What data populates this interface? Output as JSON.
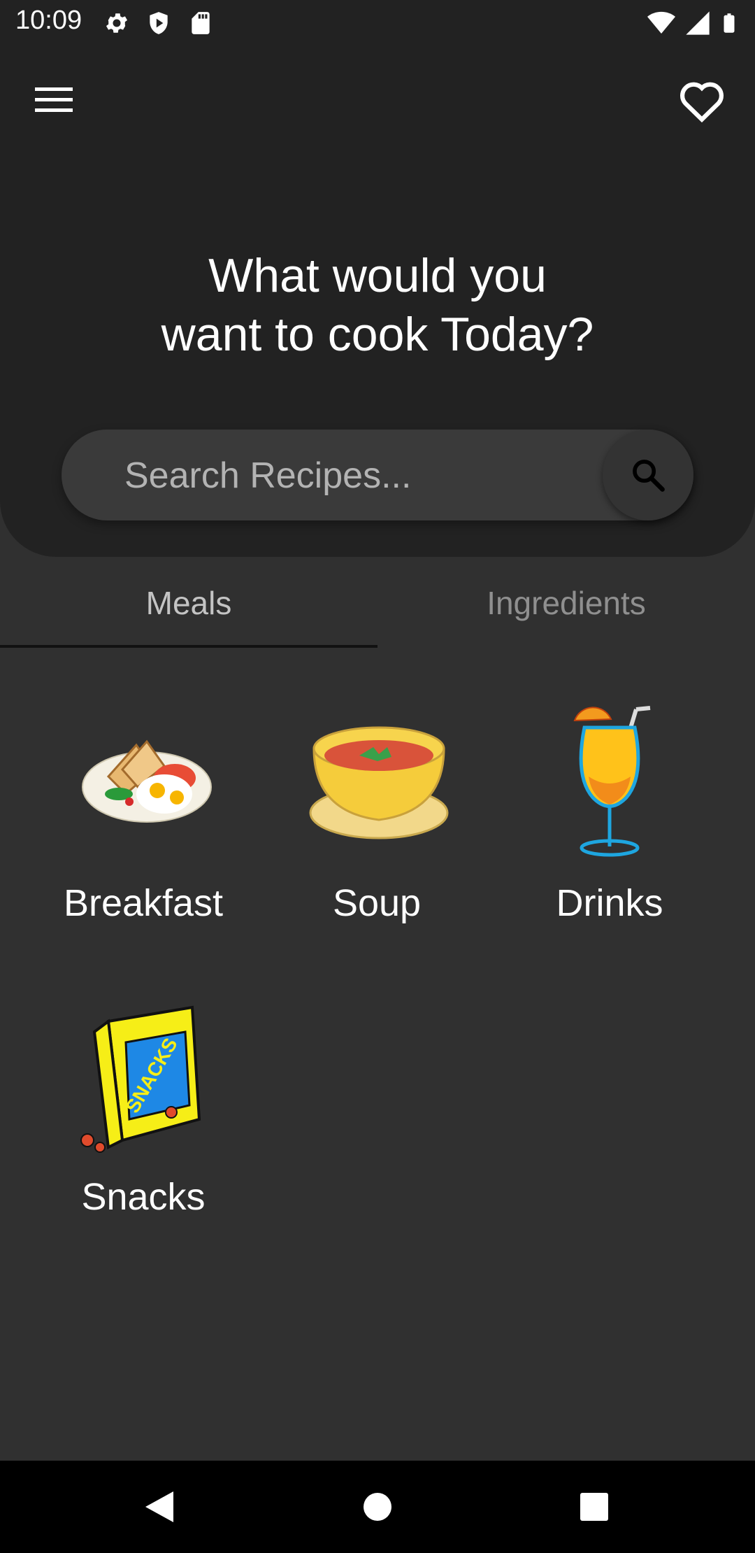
{
  "status_bar": {
    "time": "10:09",
    "left_icons": [
      "settings-icon",
      "shield-icon",
      "sd-card-icon"
    ],
    "right_icons": [
      "wifi-icon",
      "signal-icon",
      "battery-icon"
    ]
  },
  "app_bar": {
    "menu_icon": "menu-icon",
    "favorites_icon": "heart-icon"
  },
  "headline": {
    "line1": "What would you",
    "line2": "want to cook Today?"
  },
  "search": {
    "placeholder": "Search Recipes...",
    "value": "",
    "button_icon": "search-icon"
  },
  "tabs": [
    {
      "label": "Meals",
      "selected": true
    },
    {
      "label": "Ingredients",
      "selected": false
    }
  ],
  "categories": [
    {
      "label": "Breakfast",
      "icon": "breakfast-plate-icon"
    },
    {
      "label": "Soup",
      "icon": "soup-bowl-icon"
    },
    {
      "label": "Drinks",
      "icon": "cocktail-glass-icon"
    },
    {
      "label": "Snacks",
      "icon": "snack-box-icon"
    }
  ],
  "nav_bar": {
    "buttons": [
      "back-icon",
      "home-icon",
      "recents-icon"
    ]
  },
  "colors": {
    "header_bg": "#222222",
    "body_bg": "#303030",
    "search_bg": "#3a3a3a",
    "text_primary": "#ffffff",
    "tab_selected": "#c4c4c4",
    "tab_unselected": "#8f8f8f"
  }
}
